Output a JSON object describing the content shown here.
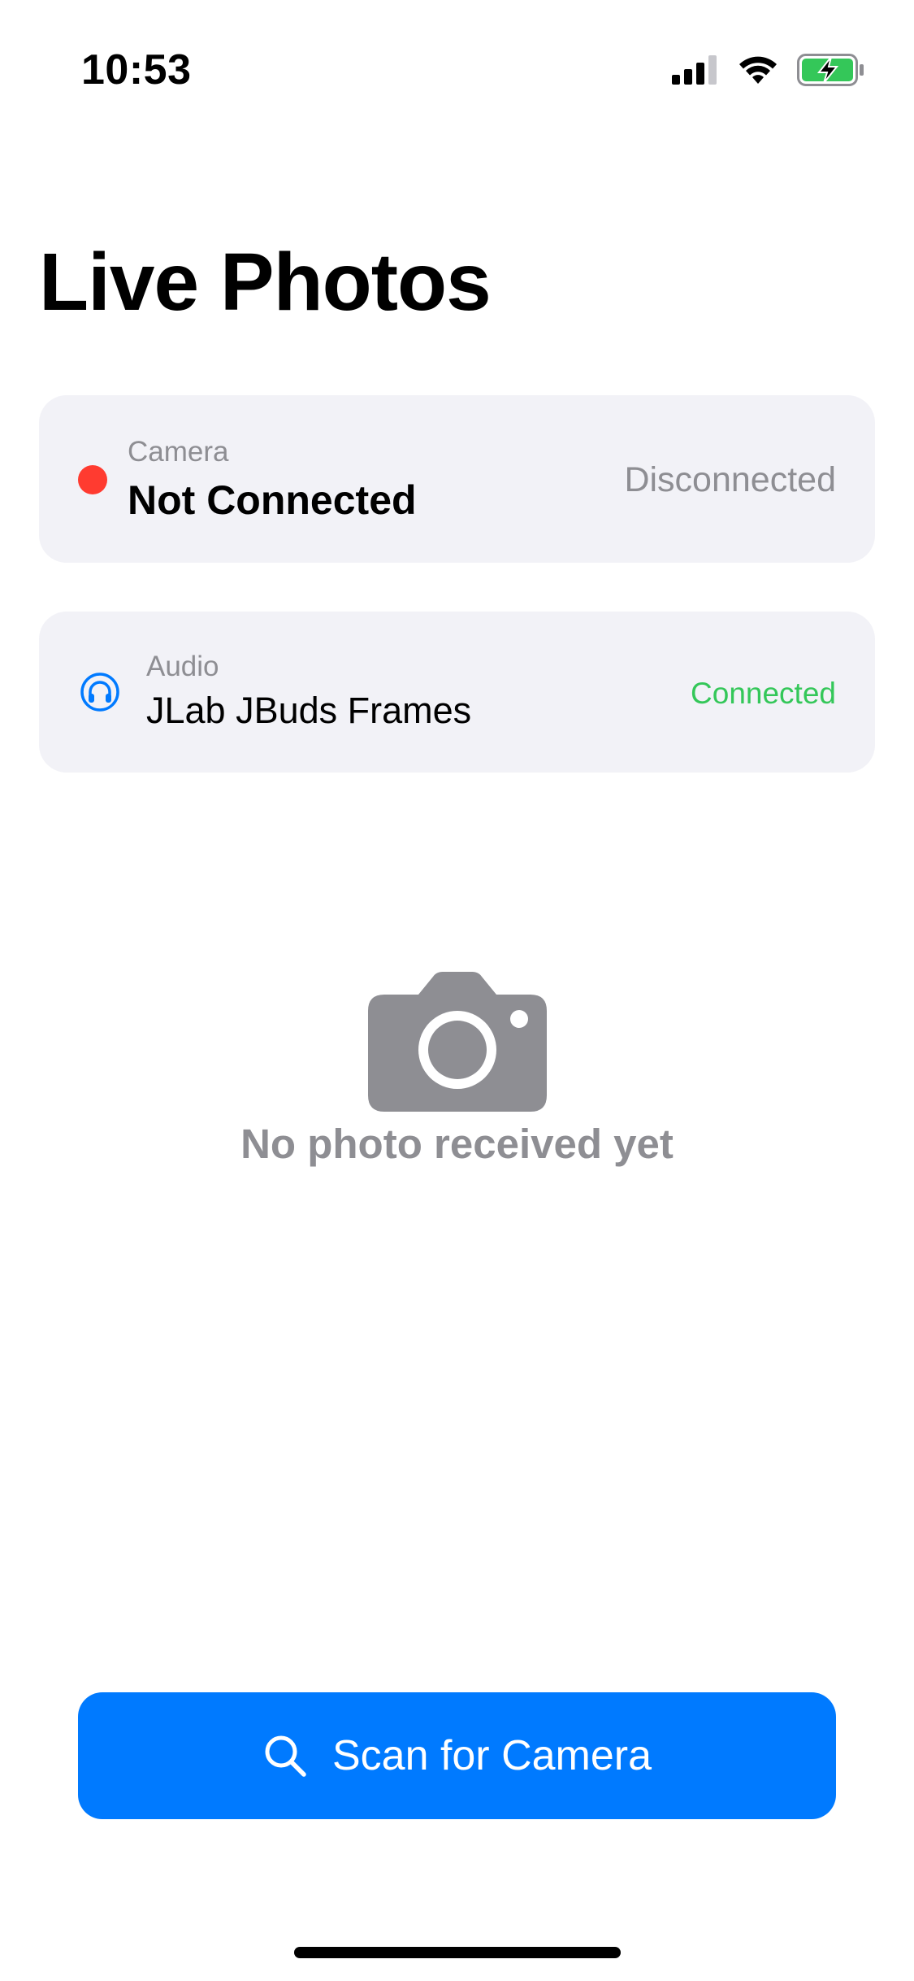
{
  "status_bar": {
    "time": "10:53",
    "icons": [
      "cellular-signal-icon",
      "wifi-icon",
      "battery-charging-icon"
    ]
  },
  "title": "Live Photos",
  "camera_card": {
    "label": "Camera",
    "value": "Not Connected",
    "status": "Disconnected",
    "indicator_color": "#ff3b30",
    "status_color": "#8e8e93"
  },
  "audio_card": {
    "icon": "headphones-icon",
    "label": "Audio",
    "value": "JLab JBuds Frames",
    "status": "Connected",
    "accent_color": "#007aff",
    "status_color": "#34c759"
  },
  "empty_state": {
    "icon": "camera-icon",
    "text": "No photo received yet"
  },
  "scan_button": {
    "icon": "search-icon",
    "label": "Scan for Camera",
    "color": "#007aff"
  }
}
